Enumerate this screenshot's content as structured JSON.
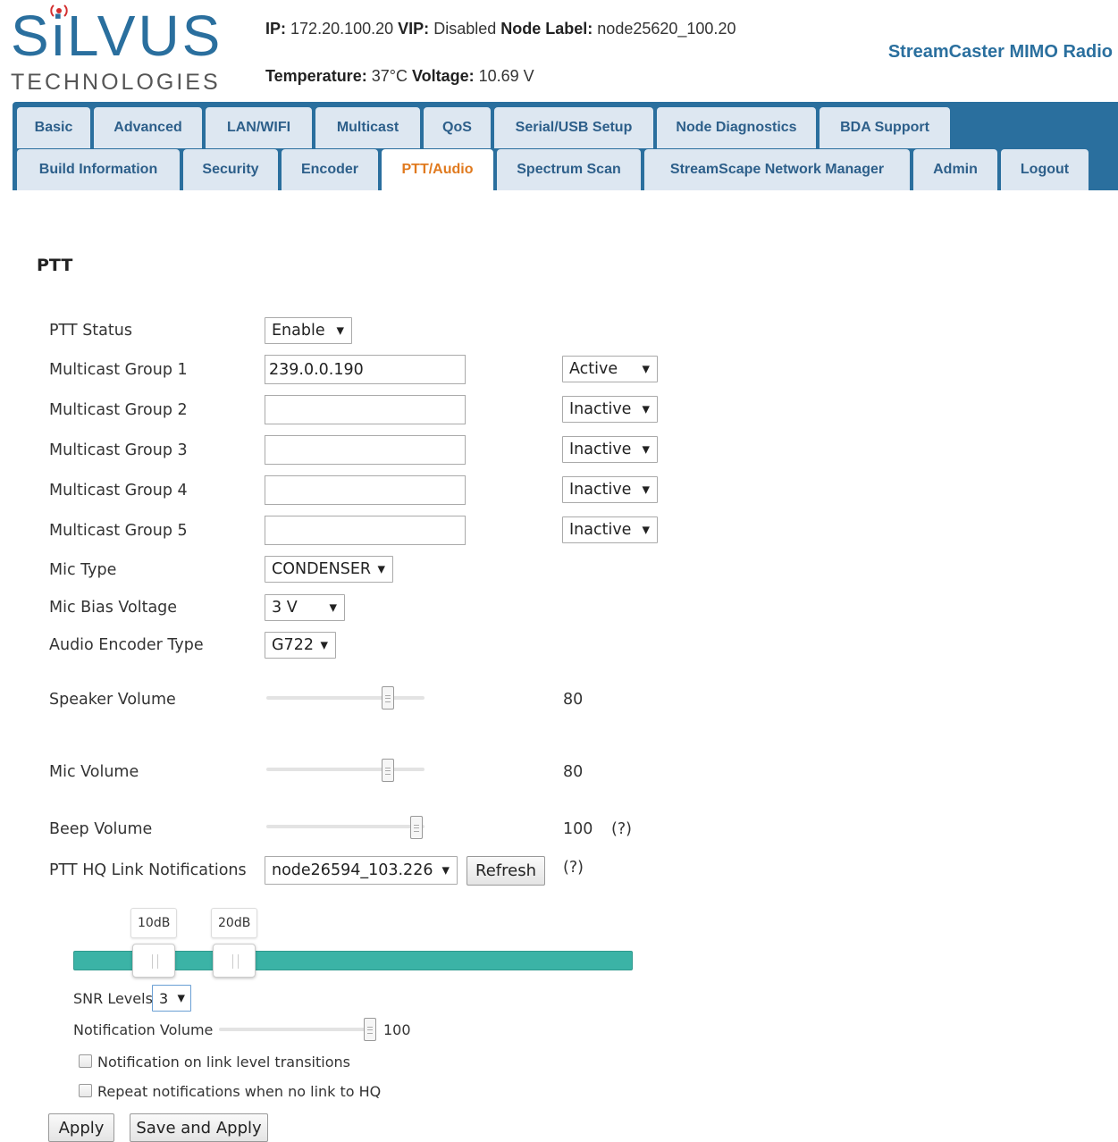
{
  "header": {
    "logo_main": "SiLVUS",
    "logo_main_prefix": "S",
    "logo_main_i": "i",
    "logo_main_suffix": "LVUS",
    "logo_sub": "TECHNOLOGIES",
    "ip_label": "IP:",
    "ip_value": "172.20.100.20",
    "vip_label": "VIP:",
    "vip_value": "Disabled",
    "node_label_label": "Node Label:",
    "node_label_value": "node25620_100.20",
    "temperature_label": "Temperature:",
    "temperature_value": "37°C",
    "voltage_label": "Voltage:",
    "voltage_value": "10.69 V",
    "product_name": "StreamCaster MIMO Radio"
  },
  "tabs_row1": [
    "Basic",
    "Advanced",
    "LAN/WIFI",
    "Multicast",
    "QoS",
    "Serial/USB Setup",
    "Node Diagnostics",
    "BDA Support"
  ],
  "tabs_row2": [
    "Build Information",
    "Security",
    "Encoder",
    "PTT/Audio",
    "Spectrum Scan",
    "StreamScape Network Manager",
    "Admin",
    "Logout"
  ],
  "active_tab": "PTT/Audio",
  "ptt": {
    "section_title": "PTT",
    "status_label": "PTT Status",
    "status_value": "Enable",
    "groups": [
      {
        "label": "Multicast Group 1",
        "address": "239.0.0.190",
        "state": "Active"
      },
      {
        "label": "Multicast Group 2",
        "address": "",
        "state": "Inactive"
      },
      {
        "label": "Multicast Group 3",
        "address": "",
        "state": "Inactive"
      },
      {
        "label": "Multicast Group 4",
        "address": "",
        "state": "Inactive"
      },
      {
        "label": "Multicast Group 5",
        "address": "",
        "state": "Inactive"
      }
    ],
    "mic_type_label": "Mic Type",
    "mic_type_value": "CONDENSER",
    "mic_bias_label": "Mic Bias Voltage",
    "mic_bias_value": "3 V",
    "encoder_label": "Audio Encoder Type",
    "encoder_value": "G722",
    "speaker_volume_label": "Speaker Volume",
    "speaker_volume_value": "80",
    "mic_volume_label": "Mic Volume",
    "mic_volume_value": "80",
    "beep_volume_label": "Beep Volume",
    "beep_volume_value": "100",
    "beep_help": "(?)",
    "hq_label": "PTT HQ Link Notifications",
    "hq_value": "node26594_103.226",
    "refresh_label": "Refresh",
    "hq_help": "(?)",
    "snr_low_tip": "10dB",
    "snr_high_tip": "20dB",
    "snr_low_value": 10,
    "snr_high_value": 20,
    "snr_levels_label": "SNR Levels",
    "snr_levels_value": "3",
    "notif_volume_label": "Notification Volume",
    "notif_volume_value": "100",
    "check_transitions_label": "Notification on link level transitions",
    "check_transitions": false,
    "check_repeat_label": "Repeat notifications when no link to HQ",
    "check_repeat": false,
    "apply_label": "Apply",
    "save_apply_label": "Save and Apply"
  },
  "colors": {
    "brand_blue": "#2a6f9e",
    "tab_bg": "#dde7f1",
    "active_tab_text": "#e07a1f",
    "snr_bar": "#3bb3a6"
  }
}
